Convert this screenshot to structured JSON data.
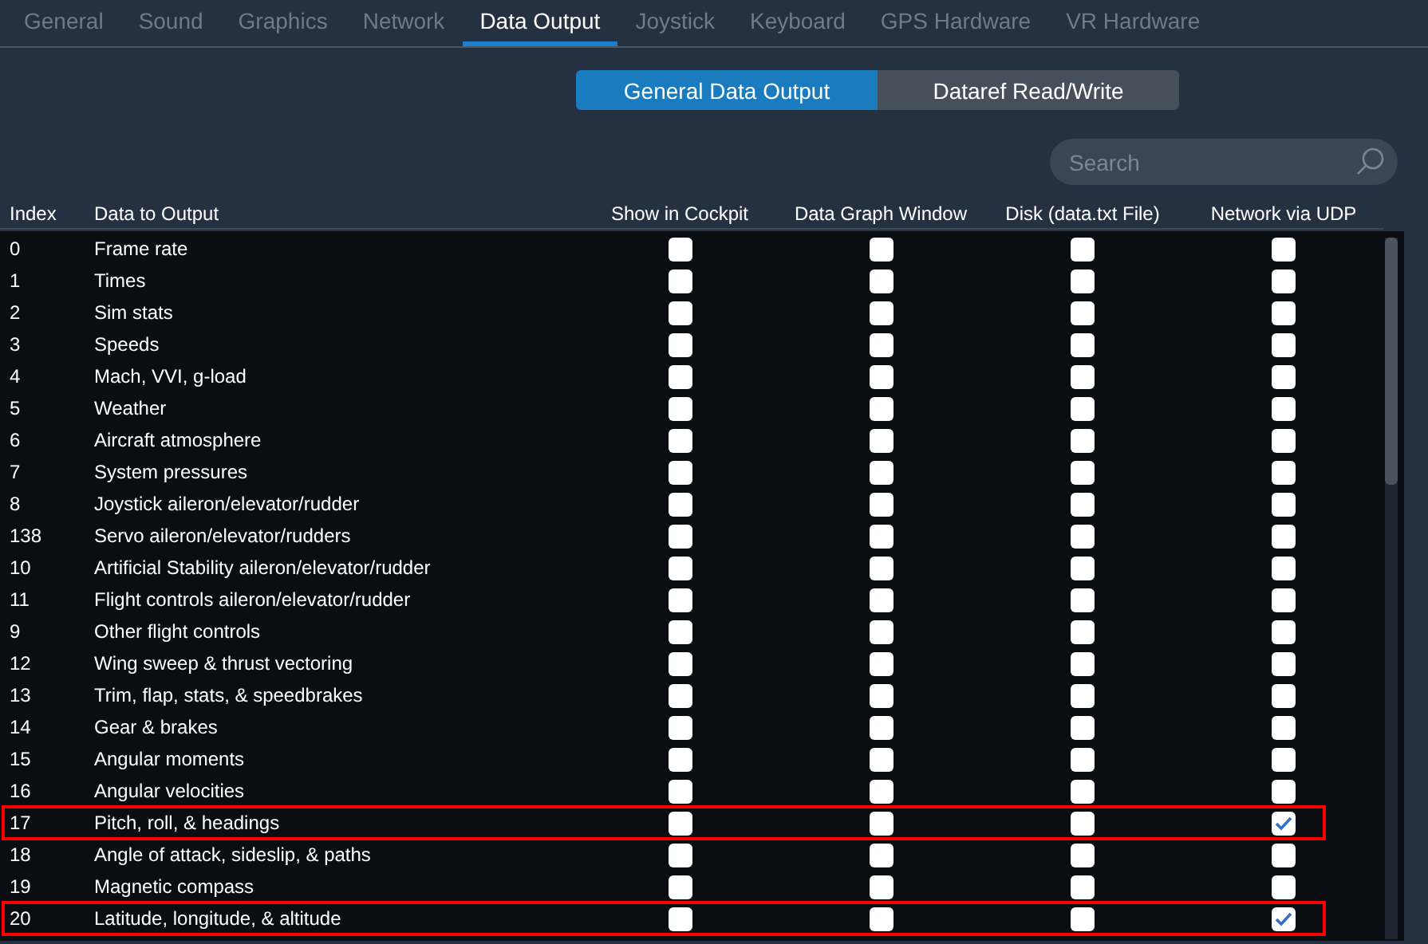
{
  "tabs": [
    {
      "label": "General",
      "selected": false
    },
    {
      "label": "Sound",
      "selected": false
    },
    {
      "label": "Graphics",
      "selected": false
    },
    {
      "label": "Network",
      "selected": false
    },
    {
      "label": "Data Output",
      "selected": true
    },
    {
      "label": "Joystick",
      "selected": false
    },
    {
      "label": "Keyboard",
      "selected": false
    },
    {
      "label": "GPS Hardware",
      "selected": false
    },
    {
      "label": "VR Hardware",
      "selected": false
    }
  ],
  "segments": [
    {
      "label": "General Data Output",
      "selected": true
    },
    {
      "label": "Dataref Read/Write",
      "selected": false
    }
  ],
  "search": {
    "placeholder": "Search"
  },
  "table": {
    "columns": [
      "Index",
      "Data to Output",
      "Show in Cockpit",
      "Data Graph Window",
      "Disk (data.txt File)",
      "Network via UDP"
    ],
    "rows": [
      {
        "index": "0",
        "name": "Frame rate",
        "checks": [
          false,
          false,
          false,
          false
        ],
        "highlighted": false
      },
      {
        "index": "1",
        "name": "Times",
        "checks": [
          false,
          false,
          false,
          false
        ],
        "highlighted": false
      },
      {
        "index": "2",
        "name": "Sim stats",
        "checks": [
          false,
          false,
          false,
          false
        ],
        "highlighted": false
      },
      {
        "index": "3",
        "name": "Speeds",
        "checks": [
          false,
          false,
          false,
          false
        ],
        "highlighted": false
      },
      {
        "index": "4",
        "name": "Mach, VVI, g-load",
        "checks": [
          false,
          false,
          false,
          false
        ],
        "highlighted": false
      },
      {
        "index": "5",
        "name": "Weather",
        "checks": [
          false,
          false,
          false,
          false
        ],
        "highlighted": false
      },
      {
        "index": "6",
        "name": "Aircraft atmosphere",
        "checks": [
          false,
          false,
          false,
          false
        ],
        "highlighted": false
      },
      {
        "index": "7",
        "name": "System pressures",
        "checks": [
          false,
          false,
          false,
          false
        ],
        "highlighted": false
      },
      {
        "index": "8",
        "name": "Joystick aileron/elevator/rudder",
        "checks": [
          false,
          false,
          false,
          false
        ],
        "highlighted": false
      },
      {
        "index": "138",
        "name": "Servo aileron/elevator/rudders",
        "checks": [
          false,
          false,
          false,
          false
        ],
        "highlighted": false
      },
      {
        "index": "10",
        "name": "Artificial Stability aileron/elevator/rudder",
        "checks": [
          false,
          false,
          false,
          false
        ],
        "highlighted": false
      },
      {
        "index": "11",
        "name": "Flight controls aileron/elevator/rudder",
        "checks": [
          false,
          false,
          false,
          false
        ],
        "highlighted": false
      },
      {
        "index": "9",
        "name": "Other flight controls",
        "checks": [
          false,
          false,
          false,
          false
        ],
        "highlighted": false
      },
      {
        "index": "12",
        "name": "Wing sweep & thrust vectoring",
        "checks": [
          false,
          false,
          false,
          false
        ],
        "highlighted": false
      },
      {
        "index": "13",
        "name": "Trim, flap, stats, & speedbrakes",
        "checks": [
          false,
          false,
          false,
          false
        ],
        "highlighted": false
      },
      {
        "index": "14",
        "name": "Gear & brakes",
        "checks": [
          false,
          false,
          false,
          false
        ],
        "highlighted": false
      },
      {
        "index": "15",
        "name": "Angular moments",
        "checks": [
          false,
          false,
          false,
          false
        ],
        "highlighted": false
      },
      {
        "index": "16",
        "name": "Angular velocities",
        "checks": [
          false,
          false,
          false,
          false
        ],
        "highlighted": false
      },
      {
        "index": "17",
        "name": "Pitch, roll, & headings",
        "checks": [
          false,
          false,
          false,
          true
        ],
        "highlighted": true
      },
      {
        "index": "18",
        "name": "Angle of attack, sideslip, & paths",
        "checks": [
          false,
          false,
          false,
          false
        ],
        "highlighted": false
      },
      {
        "index": "19",
        "name": "Magnetic compass",
        "checks": [
          false,
          false,
          false,
          false
        ],
        "highlighted": false
      },
      {
        "index": "20",
        "name": "Latitude, longitude, & altitude",
        "checks": [
          false,
          false,
          false,
          true
        ],
        "highlighted": true
      }
    ]
  }
}
